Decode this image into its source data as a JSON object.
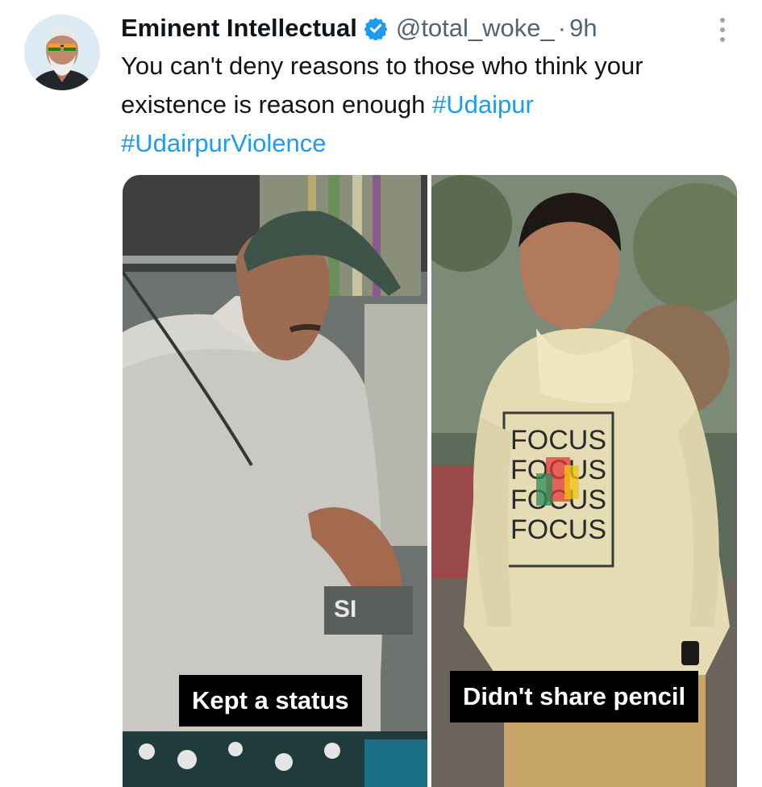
{
  "tweet": {
    "author_name": "Eminent Intellectual",
    "handle": "@total_woke_",
    "separator": "·",
    "time": "9h",
    "text_before": "You can't deny reasons to those who think your existence is reason enough",
    "hashtags": [
      "#Udaipur",
      "#UdairpurViolence"
    ]
  },
  "media": {
    "left_caption": "Kept a status",
    "right_caption": "Didn't share pencil",
    "hoodie_text": [
      "FOCUS",
      "FOCUS",
      "FOCUS",
      "FOCUS"
    ],
    "shop_sign_text": "SI"
  },
  "icons": {
    "verified": "verified-badge-icon",
    "more": "more-options-icon"
  },
  "colors": {
    "link": "#1d9bf0",
    "secondary_text": "#536471",
    "verified_badge": "#1d9bf0"
  }
}
